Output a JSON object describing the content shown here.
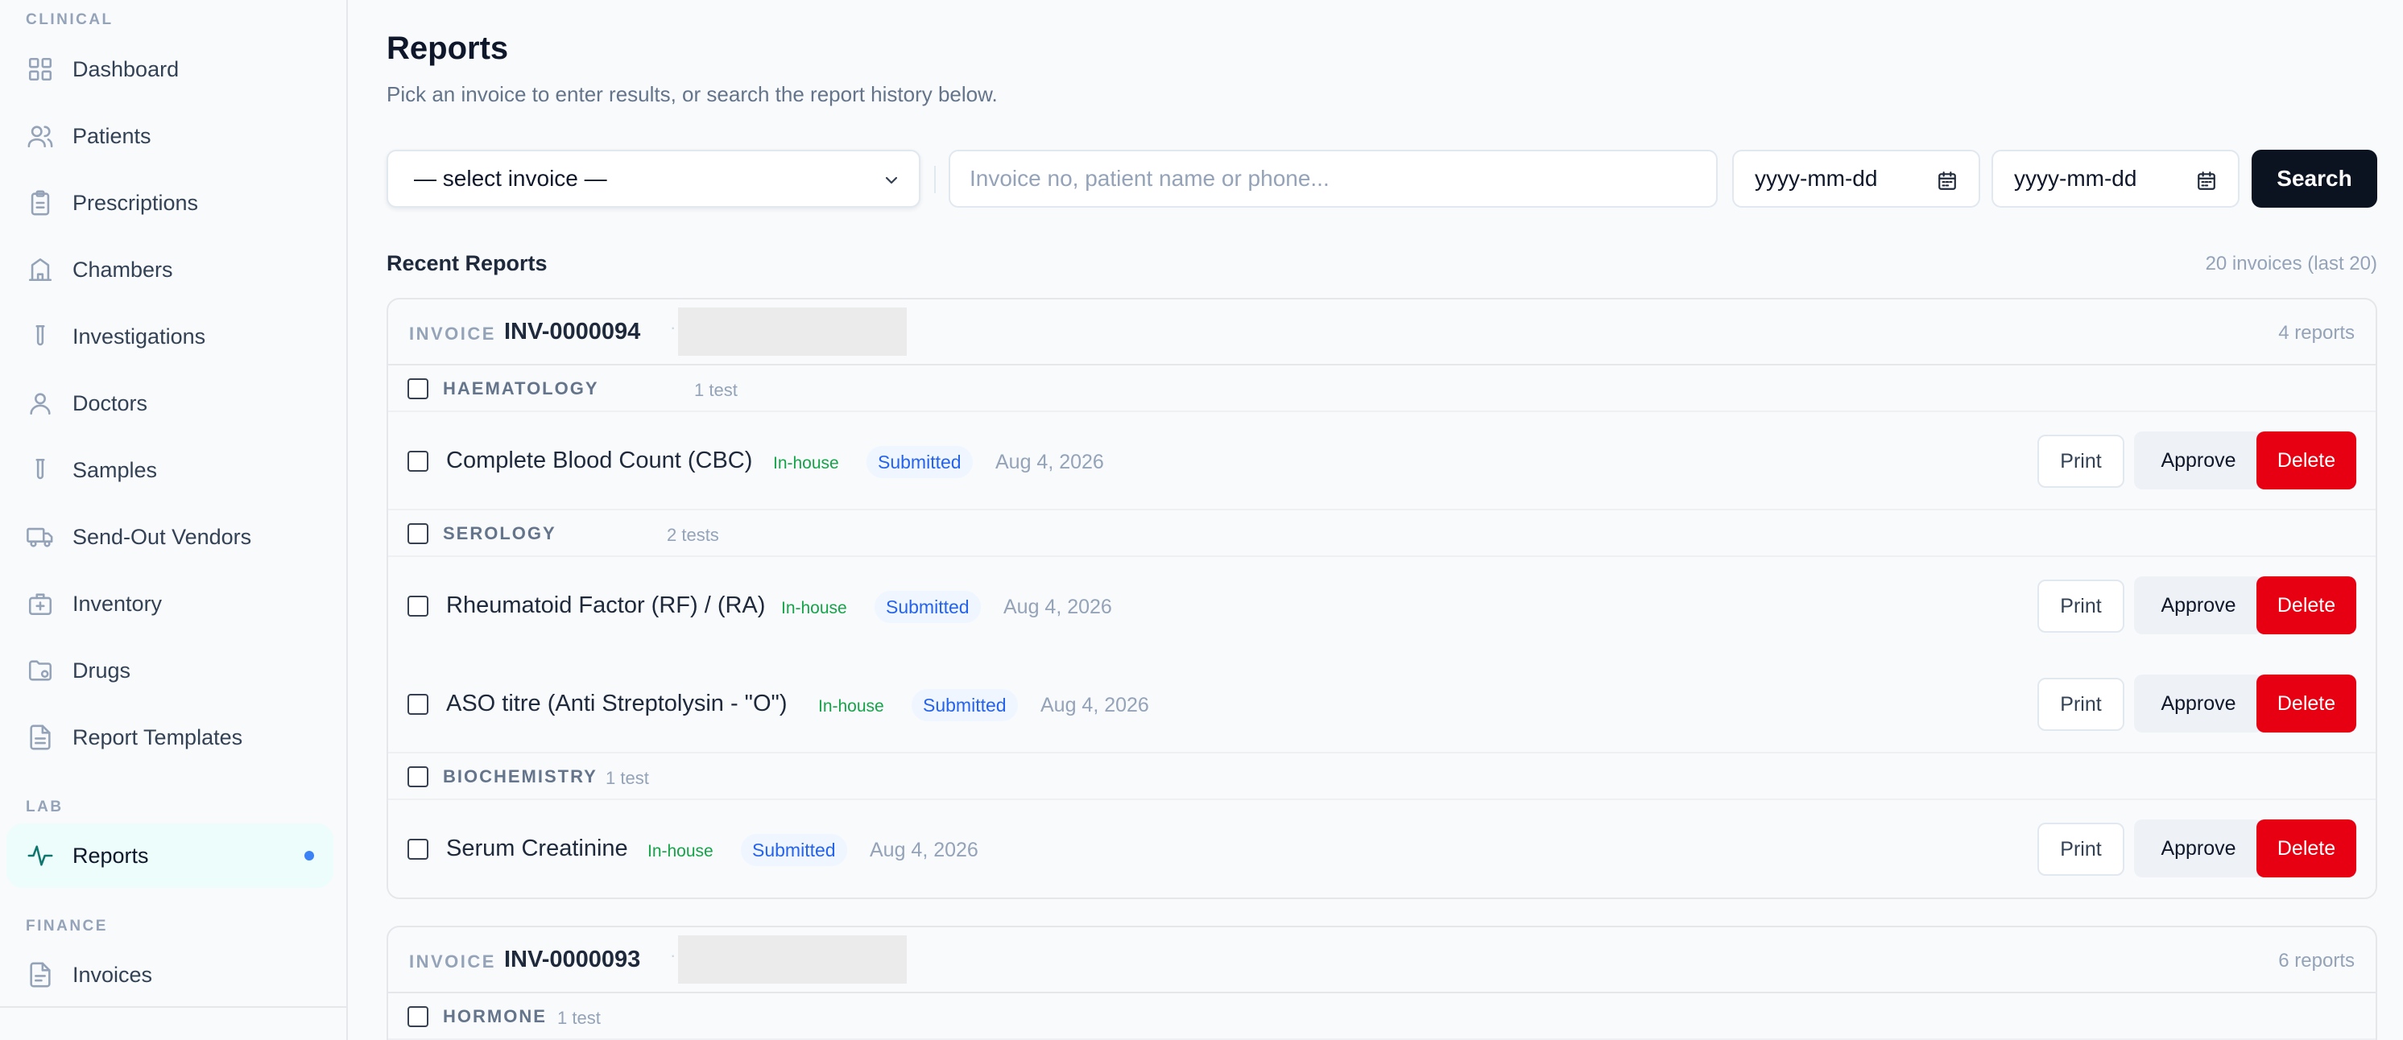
{
  "sidebar": {
    "sections": {
      "clinical": "CLINICAL",
      "lab": "LAB",
      "finance": "FINANCE"
    },
    "items": [
      {
        "label": "Dashboard",
        "icon": "grid-icon"
      },
      {
        "label": "Patients",
        "icon": "users-icon"
      },
      {
        "label": "Prescriptions",
        "icon": "clipboard-icon"
      },
      {
        "label": "Chambers",
        "icon": "building-icon"
      },
      {
        "label": "Investigations",
        "icon": "test-tube-icon"
      },
      {
        "label": "Doctors",
        "icon": "user-icon"
      },
      {
        "label": "Samples",
        "icon": "test-tube-icon"
      },
      {
        "label": "Send-Out Vendors",
        "icon": "truck-icon"
      },
      {
        "label": "Inventory",
        "icon": "briefcase-medical-icon"
      },
      {
        "label": "Drugs",
        "icon": "folder-icon"
      },
      {
        "label": "Report Templates",
        "icon": "file-text-icon"
      },
      {
        "label": "Reports",
        "icon": "activity-icon",
        "active": true
      },
      {
        "label": "Invoices",
        "icon": "file-icon"
      }
    ]
  },
  "header": {
    "title": "Reports",
    "subtitle": "Pick an invoice to enter results, or search the report history below."
  },
  "filters": {
    "invoice_select": "— select invoice —",
    "search_placeholder": "Invoice no, patient name or phone...",
    "date_from": "yyyy-mm-dd",
    "date_to": "yyyy-mm-dd",
    "search_label": "Search"
  },
  "recent": {
    "title": "Recent Reports",
    "count": "20 invoices (last 20)"
  },
  "labels": {
    "invoice": "INVOICE",
    "print": "Print",
    "approve": "Approve",
    "delete": "Delete"
  },
  "invoices": [
    {
      "number": "INV-0000094",
      "reports": "4 reports",
      "groups": [
        {
          "name": "HAEMATOLOGY",
          "count": "1 test",
          "tests": [
            {
              "name": "Complete Blood Count (CBC)",
              "source": "In-house",
              "status": "Submitted",
              "date": "Aug 4, 2026"
            }
          ]
        },
        {
          "name": "SEROLOGY",
          "count": "2 tests",
          "tests": [
            {
              "name": "Rheumatoid Factor (RF) / (RA)",
              "source": "In-house",
              "status": "Submitted",
              "date": "Aug 4, 2026"
            },
            {
              "name": "ASO titre (Anti Streptolysin - \"O\")",
              "source": "In-house",
              "status": "Submitted",
              "date": "Aug 4, 2026"
            }
          ]
        },
        {
          "name": "BIOCHEMISTRY",
          "count": "1 test",
          "tests": [
            {
              "name": "Serum Creatinine",
              "source": "In-house",
              "status": "Submitted",
              "date": "Aug 4, 2026"
            }
          ]
        }
      ]
    },
    {
      "number": "INV-0000093",
      "reports": "6 reports",
      "groups": [
        {
          "name": "HORMONE",
          "count": "1 test",
          "tests": []
        }
      ]
    }
  ],
  "colors": {
    "accent": "#0f766e",
    "active_bg": "#ecfdfb",
    "delete": "#e70012",
    "status_blue": "#2563eb",
    "inhouse_green": "#16a34a"
  }
}
